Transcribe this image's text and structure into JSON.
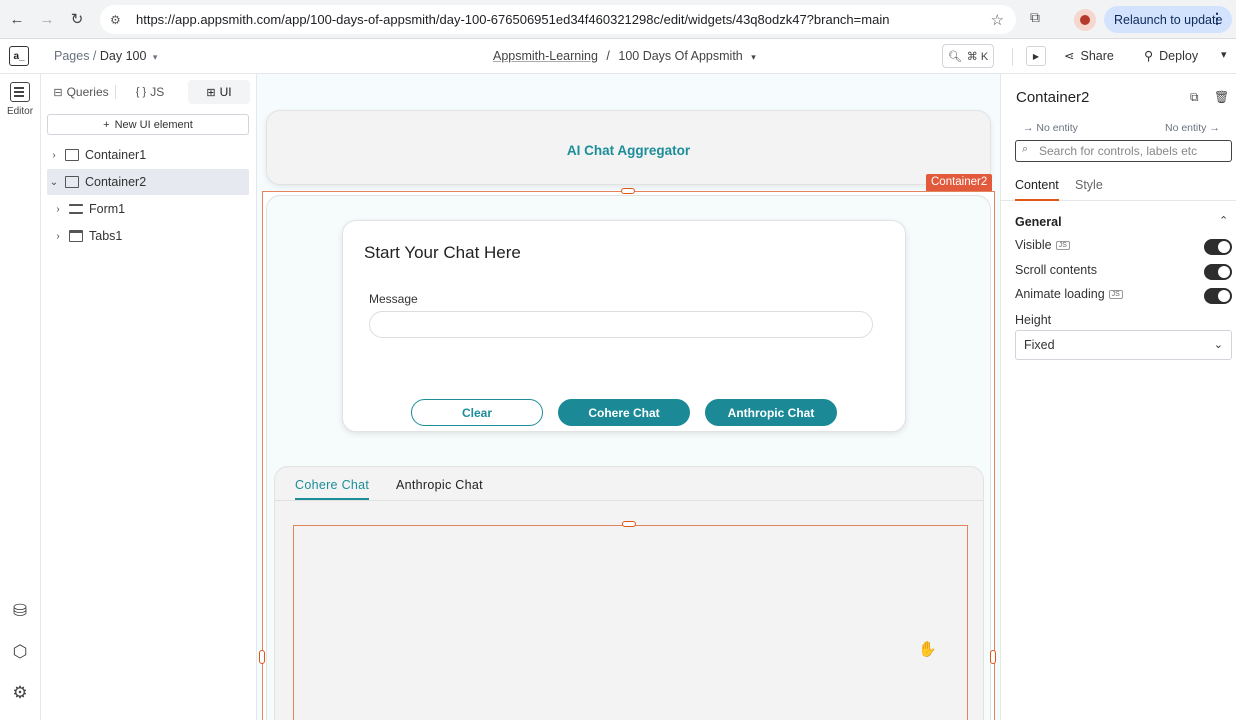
{
  "browser": {
    "url": "https://app.appsmith.com/app/100-days-of-appsmith/day-100-676506951ed34f460321298c/edit/widgets/43q8odzk47?branch=main",
    "relaunch_label": "Relaunch to update"
  },
  "header": {
    "logo_text": "a_",
    "pages_label": "Pages /",
    "page_name": "Day 100",
    "workspace": "Appsmith-Learning",
    "separator": "/",
    "app_name": "100 Days Of Appsmith",
    "search_shortcut": "⌘ K",
    "share_label": "Share",
    "deploy_label": "Deploy"
  },
  "rail": {
    "editor_label": "Editor"
  },
  "explorer": {
    "tabs": [
      {
        "label": "Queries"
      },
      {
        "label": "JS"
      },
      {
        "label": "UI"
      }
    ],
    "new_ui_label": "New UI element",
    "tree": [
      {
        "label": "Container1"
      },
      {
        "label": "Container2"
      },
      {
        "label": "Form1"
      },
      {
        "label": "Tabs1"
      }
    ]
  },
  "canvas": {
    "app_title": "AI Chat Aggregator",
    "selected_tag": "Container2",
    "form": {
      "title": "Start Your Chat Here",
      "message_label": "Message",
      "message_value": "",
      "buttons": {
        "clear": "Clear",
        "cohere": "Cohere Chat",
        "anthropic": "Anthropic Chat"
      }
    },
    "tabs": [
      {
        "label": "Cohere Chat",
        "active": true
      },
      {
        "label": "Anthropic Chat",
        "active": false
      }
    ]
  },
  "props": {
    "title": "Container2",
    "entity_left": "No entity",
    "entity_right": "No entity",
    "search_placeholder": "Search for controls, labels etc",
    "tabs": [
      {
        "label": "Content"
      },
      {
        "label": "Style"
      }
    ],
    "section": "General",
    "js_badge": "JS",
    "rows": [
      {
        "label": "Visible",
        "js": true,
        "on": true
      },
      {
        "label": "Scroll contents",
        "js": false,
        "on": true
      },
      {
        "label": "Animate loading",
        "js": true,
        "on": true
      }
    ],
    "height_label": "Height",
    "height_value": "Fixed"
  },
  "colors": {
    "accent": "#1d8d9a",
    "selection": "#e3593b",
    "brand": "#e15615"
  }
}
